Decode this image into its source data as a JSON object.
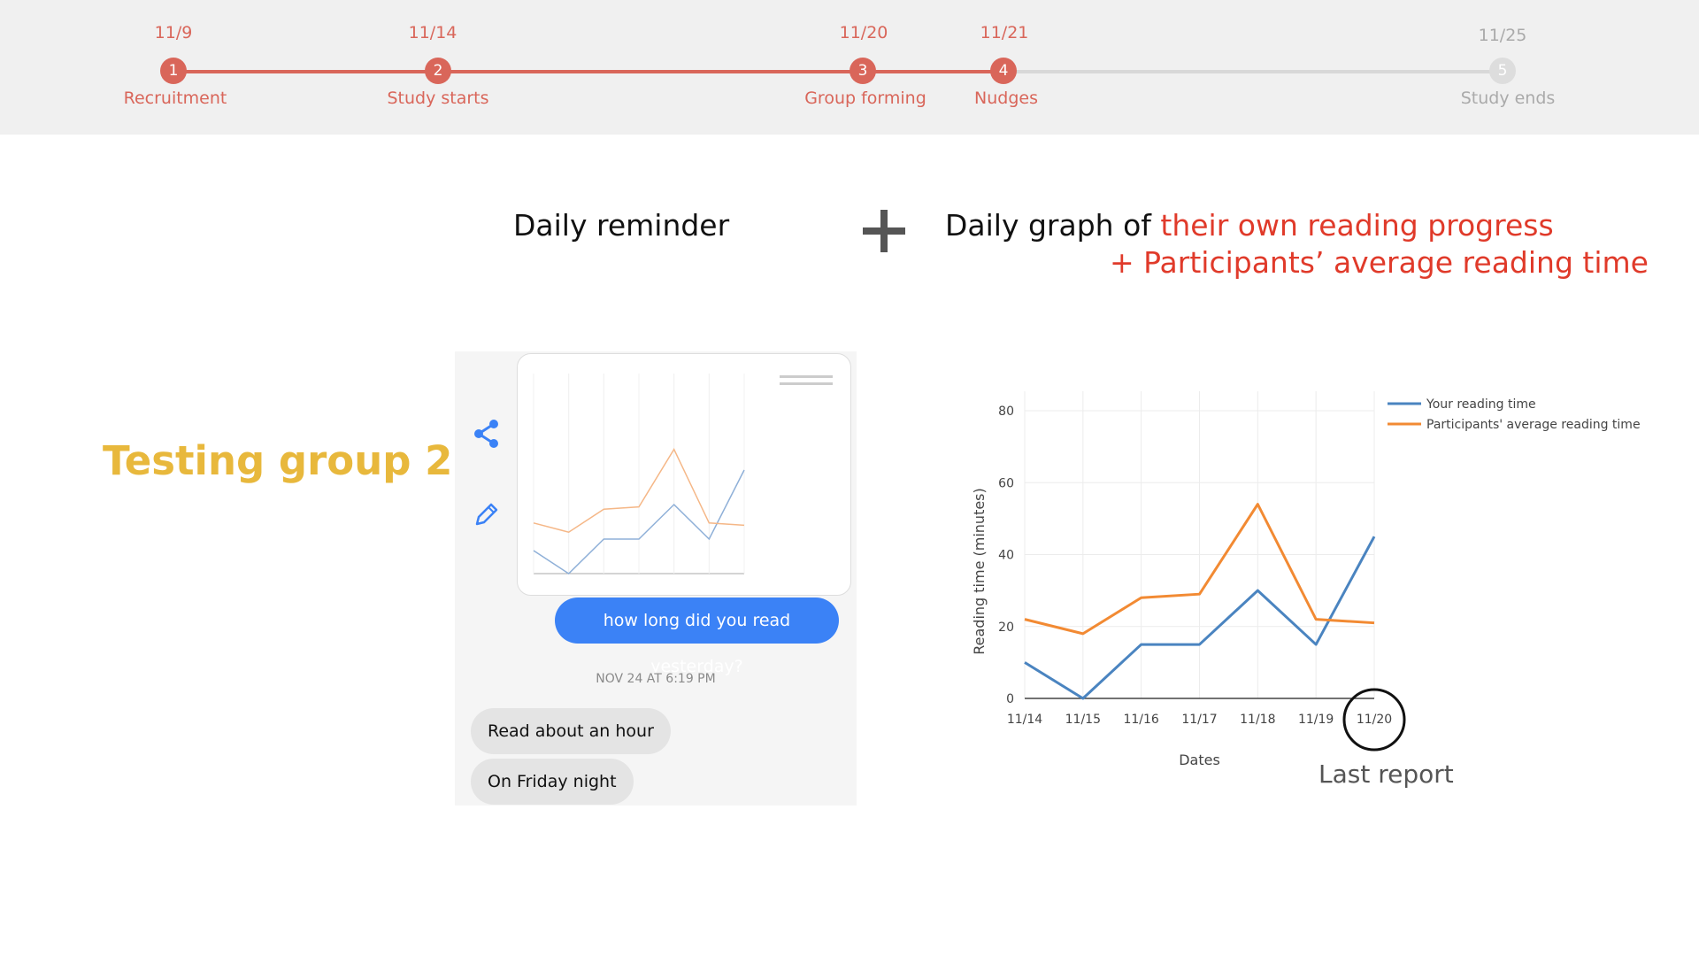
{
  "colors": {
    "accent": "#d9665a",
    "inactive": "#cccccc",
    "highlight": "#e03a2a",
    "group": "#e8b83c",
    "blue": "#4a84c0",
    "orange": "#f28a33"
  },
  "timeline": {
    "steps": [
      {
        "date": "11/9",
        "num": "1",
        "label": "Recruitment"
      },
      {
        "date": "11/14",
        "num": "2",
        "label": "Study starts"
      },
      {
        "date": "11/20",
        "num": "3",
        "label": "Group forming"
      },
      {
        "date": "11/21",
        "num": "4",
        "label": "Nudges"
      },
      {
        "date": "11/25",
        "num": "5",
        "label": "Study ends"
      }
    ]
  },
  "headline": {
    "left": "Daily reminder",
    "right_prefix": "Daily graph of",
    "right_highlight": "their own reading progress",
    "right_line2": "+ Participants’ average reading time"
  },
  "group_title": "Testing group 2",
  "chat": {
    "share_icon": "share-icon",
    "edit_icon": "pencil-icon",
    "outgoing": "how long did you read yesterday?",
    "timestamp": "NOV 24 AT 6:19 PM",
    "incoming": [
      "Read about an hour",
      "On Friday night"
    ]
  },
  "chart_data": {
    "type": "line",
    "categories": [
      "11/14",
      "11/15",
      "11/16",
      "11/17",
      "11/18",
      "11/19",
      "11/20"
    ],
    "series": [
      {
        "name": "Your reading time",
        "values": [
          10,
          0,
          15,
          15,
          30,
          15,
          45
        ]
      },
      {
        "name": "Participants' average reading time",
        "values": [
          22,
          18,
          28,
          29,
          54,
          22,
          21
        ]
      }
    ],
    "xlabel": "Dates",
    "ylabel": "Reading time (minutes)",
    "ylim": [
      0,
      80
    ],
    "yticks": [
      0,
      20,
      40,
      60,
      80
    ],
    "grid": true,
    "legend": "top-right",
    "annotation": "Last report"
  }
}
